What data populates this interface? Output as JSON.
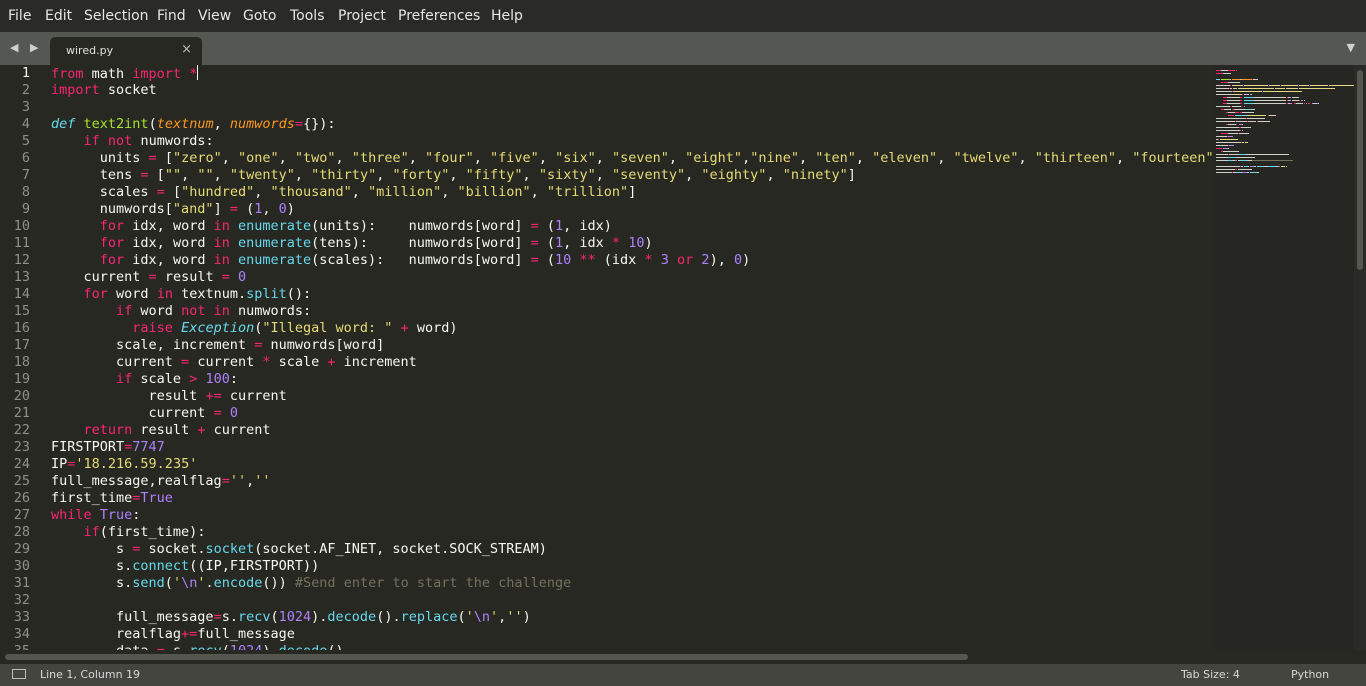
{
  "menu": [
    "File",
    "Edit",
    "Selection",
    "Find",
    "View",
    "Goto",
    "Tools",
    "Project",
    "Preferences",
    "Help"
  ],
  "tab": {
    "title": "wired.py",
    "close_glyph": "×"
  },
  "nav_arrows": "◀ ▶",
  "dropdown_glyph": "▼",
  "editor": {
    "current_line": 1,
    "lines": [
      {
        "n": "1",
        "t": [
          {
            "c": "kw",
            "s": "from"
          },
          {
            "s": " math "
          },
          {
            "c": "kw",
            "s": "import"
          },
          {
            "s": " "
          },
          {
            "c": "kw",
            "s": "*"
          }
        ]
      },
      {
        "n": "2",
        "t": [
          {
            "c": "kw",
            "s": "import"
          },
          {
            "s": " socket"
          }
        ]
      },
      {
        "n": "3",
        "t": []
      },
      {
        "n": "4",
        "t": [
          {
            "c": "sp",
            "s": "def"
          },
          {
            "s": " "
          },
          {
            "c": "fn",
            "s": "text2int"
          },
          {
            "s": "("
          },
          {
            "c": "pa",
            "s": "textnum"
          },
          {
            "s": ", "
          },
          {
            "c": "pa",
            "s": "numwords"
          },
          {
            "c": "kw",
            "s": "="
          },
          {
            "s": "{}):"
          }
        ]
      },
      {
        "n": "5",
        "t": [
          {
            "s": "    "
          },
          {
            "c": "kw",
            "s": "if"
          },
          {
            "s": " "
          },
          {
            "c": "kw",
            "s": "not"
          },
          {
            "s": " numwords:"
          }
        ]
      },
      {
        "n": "6",
        "t": [
          {
            "s": "      units "
          },
          {
            "c": "kw",
            "s": "="
          },
          {
            "s": " ["
          },
          {
            "c": "st",
            "s": "\"zero\""
          },
          {
            "s": ", "
          },
          {
            "c": "st",
            "s": "\"one\""
          },
          {
            "s": ", "
          },
          {
            "c": "st",
            "s": "\"two\""
          },
          {
            "s": ", "
          },
          {
            "c": "st",
            "s": "\"three\""
          },
          {
            "s": ", "
          },
          {
            "c": "st",
            "s": "\"four\""
          },
          {
            "s": ", "
          },
          {
            "c": "st",
            "s": "\"five\""
          },
          {
            "s": ", "
          },
          {
            "c": "st",
            "s": "\"six\""
          },
          {
            "s": ", "
          },
          {
            "c": "st",
            "s": "\"seven\""
          },
          {
            "s": ", "
          },
          {
            "c": "st",
            "s": "\"eight\""
          },
          {
            "s": ","
          },
          {
            "c": "st",
            "s": "\"nine\""
          },
          {
            "s": ", "
          },
          {
            "c": "st",
            "s": "\"ten\""
          },
          {
            "s": ", "
          },
          {
            "c": "st",
            "s": "\"eleven\""
          },
          {
            "s": ", "
          },
          {
            "c": "st",
            "s": "\"twelve\""
          },
          {
            "s": ", "
          },
          {
            "c": "st",
            "s": "\"thirteen\""
          },
          {
            "s": ", "
          },
          {
            "c": "st",
            "s": "\"fourteen\""
          },
          {
            "s": ","
          }
        ]
      },
      {
        "n": "7",
        "t": [
          {
            "s": "      tens "
          },
          {
            "c": "kw",
            "s": "="
          },
          {
            "s": " ["
          },
          {
            "c": "st",
            "s": "\"\""
          },
          {
            "s": ", "
          },
          {
            "c": "st",
            "s": "\"\""
          },
          {
            "s": ", "
          },
          {
            "c": "st",
            "s": "\"twenty\""
          },
          {
            "s": ", "
          },
          {
            "c": "st",
            "s": "\"thirty\""
          },
          {
            "s": ", "
          },
          {
            "c": "st",
            "s": "\"forty\""
          },
          {
            "s": ", "
          },
          {
            "c": "st",
            "s": "\"fifty\""
          },
          {
            "s": ", "
          },
          {
            "c": "st",
            "s": "\"sixty\""
          },
          {
            "s": ", "
          },
          {
            "c": "st",
            "s": "\"seventy\""
          },
          {
            "s": ", "
          },
          {
            "c": "st",
            "s": "\"eighty\""
          },
          {
            "s": ", "
          },
          {
            "c": "st",
            "s": "\"ninety\""
          },
          {
            "s": "]"
          }
        ]
      },
      {
        "n": "8",
        "t": [
          {
            "s": "      scales "
          },
          {
            "c": "kw",
            "s": "="
          },
          {
            "s": " ["
          },
          {
            "c": "st",
            "s": "\"hundred\""
          },
          {
            "s": ", "
          },
          {
            "c": "st",
            "s": "\"thousand\""
          },
          {
            "s": ", "
          },
          {
            "c": "st",
            "s": "\"million\""
          },
          {
            "s": ", "
          },
          {
            "c": "st",
            "s": "\"billion\""
          },
          {
            "s": ", "
          },
          {
            "c": "st",
            "s": "\"trillion\""
          },
          {
            "s": "]"
          }
        ]
      },
      {
        "n": "9",
        "t": [
          {
            "s": "      numwords["
          },
          {
            "c": "st",
            "s": "\"and\""
          },
          {
            "s": "] "
          },
          {
            "c": "kw",
            "s": "="
          },
          {
            "s": " ("
          },
          {
            "c": "nu",
            "s": "1"
          },
          {
            "s": ", "
          },
          {
            "c": "nu",
            "s": "0"
          },
          {
            "s": ")"
          }
        ]
      },
      {
        "n": "10",
        "t": [
          {
            "s": "      "
          },
          {
            "c": "kw",
            "s": "for"
          },
          {
            "s": " idx, word "
          },
          {
            "c": "kw",
            "s": "in"
          },
          {
            "s": " "
          },
          {
            "c": "bi",
            "s": "enumerate"
          },
          {
            "s": "(units):    numwords[word] "
          },
          {
            "c": "kw",
            "s": "="
          },
          {
            "s": " ("
          },
          {
            "c": "nu",
            "s": "1"
          },
          {
            "s": ", idx)"
          }
        ]
      },
      {
        "n": "11",
        "t": [
          {
            "s": "      "
          },
          {
            "c": "kw",
            "s": "for"
          },
          {
            "s": " idx, word "
          },
          {
            "c": "kw",
            "s": "in"
          },
          {
            "s": " "
          },
          {
            "c": "bi",
            "s": "enumerate"
          },
          {
            "s": "(tens):     numwords[word] "
          },
          {
            "c": "kw",
            "s": "="
          },
          {
            "s": " ("
          },
          {
            "c": "nu",
            "s": "1"
          },
          {
            "s": ", idx "
          },
          {
            "c": "kw",
            "s": "*"
          },
          {
            "s": " "
          },
          {
            "c": "nu",
            "s": "10"
          },
          {
            "s": ")"
          }
        ]
      },
      {
        "n": "12",
        "t": [
          {
            "s": "      "
          },
          {
            "c": "kw",
            "s": "for"
          },
          {
            "s": " idx, word "
          },
          {
            "c": "kw",
            "s": "in"
          },
          {
            "s": " "
          },
          {
            "c": "bi",
            "s": "enumerate"
          },
          {
            "s": "(scales):   numwords[word] "
          },
          {
            "c": "kw",
            "s": "="
          },
          {
            "s": " ("
          },
          {
            "c": "nu",
            "s": "10"
          },
          {
            "s": " "
          },
          {
            "c": "kw",
            "s": "**"
          },
          {
            "s": " (idx "
          },
          {
            "c": "kw",
            "s": "*"
          },
          {
            "s": " "
          },
          {
            "c": "nu",
            "s": "3"
          },
          {
            "s": " "
          },
          {
            "c": "kw",
            "s": "or"
          },
          {
            "s": " "
          },
          {
            "c": "nu",
            "s": "2"
          },
          {
            "s": "), "
          },
          {
            "c": "nu",
            "s": "0"
          },
          {
            "s": ")"
          }
        ]
      },
      {
        "n": "13",
        "t": [
          {
            "s": "    current "
          },
          {
            "c": "kw",
            "s": "="
          },
          {
            "s": " result "
          },
          {
            "c": "kw",
            "s": "="
          },
          {
            "s": " "
          },
          {
            "c": "nu",
            "s": "0"
          }
        ]
      },
      {
        "n": "14",
        "t": [
          {
            "s": "    "
          },
          {
            "c": "kw",
            "s": "for"
          },
          {
            "s": " word "
          },
          {
            "c": "kw",
            "s": "in"
          },
          {
            "s": " textnum."
          },
          {
            "c": "bi",
            "s": "split"
          },
          {
            "s": "():"
          }
        ]
      },
      {
        "n": "15",
        "t": [
          {
            "s": "        "
          },
          {
            "c": "kw",
            "s": "if"
          },
          {
            "s": " word "
          },
          {
            "c": "kw",
            "s": "not"
          },
          {
            "s": " "
          },
          {
            "c": "kw",
            "s": "in"
          },
          {
            "s": " numwords:"
          }
        ]
      },
      {
        "n": "16",
        "t": [
          {
            "s": "          "
          },
          {
            "c": "kw",
            "s": "raise"
          },
          {
            "s": " "
          },
          {
            "c": "sp",
            "s": "Exception"
          },
          {
            "s": "("
          },
          {
            "c": "st",
            "s": "\"Illegal word: \""
          },
          {
            "s": " "
          },
          {
            "c": "kw",
            "s": "+"
          },
          {
            "s": " word)"
          }
        ]
      },
      {
        "n": "17",
        "t": [
          {
            "s": "        scale, increment "
          },
          {
            "c": "kw",
            "s": "="
          },
          {
            "s": " numwords[word]"
          }
        ]
      },
      {
        "n": "18",
        "t": [
          {
            "s": "        current "
          },
          {
            "c": "kw",
            "s": "="
          },
          {
            "s": " current "
          },
          {
            "c": "kw",
            "s": "*"
          },
          {
            "s": " scale "
          },
          {
            "c": "kw",
            "s": "+"
          },
          {
            "s": " increment"
          }
        ]
      },
      {
        "n": "19",
        "t": [
          {
            "s": "        "
          },
          {
            "c": "kw",
            "s": "if"
          },
          {
            "s": " scale "
          },
          {
            "c": "kw",
            "s": ">"
          },
          {
            "s": " "
          },
          {
            "c": "nu",
            "s": "100"
          },
          {
            "s": ":"
          }
        ]
      },
      {
        "n": "20",
        "t": [
          {
            "s": "            result "
          },
          {
            "c": "kw",
            "s": "+="
          },
          {
            "s": " current"
          }
        ]
      },
      {
        "n": "21",
        "t": [
          {
            "s": "            current "
          },
          {
            "c": "kw",
            "s": "="
          },
          {
            "s": " "
          },
          {
            "c": "nu",
            "s": "0"
          }
        ]
      },
      {
        "n": "22",
        "t": [
          {
            "s": "    "
          },
          {
            "c": "kw",
            "s": "return"
          },
          {
            "s": " result "
          },
          {
            "c": "kw",
            "s": "+"
          },
          {
            "s": " current"
          }
        ]
      },
      {
        "n": "23",
        "t": [
          {
            "s": "FIRSTPORT"
          },
          {
            "c": "kw",
            "s": "="
          },
          {
            "c": "nu",
            "s": "7747"
          }
        ]
      },
      {
        "n": "24",
        "t": [
          {
            "s": "IP"
          },
          {
            "c": "kw",
            "s": "="
          },
          {
            "c": "st",
            "s": "'18.216.59.235'"
          }
        ]
      },
      {
        "n": "25",
        "t": [
          {
            "s": "full_message,realflag"
          },
          {
            "c": "kw",
            "s": "="
          },
          {
            "c": "st",
            "s": "''"
          },
          {
            "s": ","
          },
          {
            "c": "st",
            "s": "''"
          }
        ]
      },
      {
        "n": "26",
        "t": [
          {
            "s": "first_time"
          },
          {
            "c": "kw",
            "s": "="
          },
          {
            "c": "nu",
            "s": "True"
          }
        ]
      },
      {
        "n": "27",
        "t": [
          {
            "c": "kw",
            "s": "while"
          },
          {
            "s": " "
          },
          {
            "c": "nu",
            "s": "True"
          },
          {
            "s": ":"
          }
        ]
      },
      {
        "n": "28",
        "t": [
          {
            "s": "    "
          },
          {
            "c": "kw",
            "s": "if"
          },
          {
            "s": "(first_time):"
          }
        ]
      },
      {
        "n": "29",
        "t": [
          {
            "s": "        s "
          },
          {
            "c": "kw",
            "s": "="
          },
          {
            "s": " socket."
          },
          {
            "c": "bi",
            "s": "socket"
          },
          {
            "s": "(socket.AF_INET, socket.SOCK_STREAM)"
          }
        ]
      },
      {
        "n": "30",
        "t": [
          {
            "s": "        s."
          },
          {
            "c": "bi",
            "s": "connect"
          },
          {
            "s": "((IP,FIRSTPORT))"
          }
        ]
      },
      {
        "n": "31",
        "t": [
          {
            "s": "        s."
          },
          {
            "c": "bi",
            "s": "send"
          },
          {
            "s": "("
          },
          {
            "c": "st",
            "s": "'"
          },
          {
            "c": "nu",
            "s": "\\n"
          },
          {
            "c": "st",
            "s": "'"
          },
          {
            "s": "."
          },
          {
            "c": "bi",
            "s": "encode"
          },
          {
            "s": "()) "
          },
          {
            "c": "cm",
            "s": "#Send enter to start the challenge"
          }
        ]
      },
      {
        "n": "32",
        "t": []
      },
      {
        "n": "33",
        "t": [
          {
            "s": "        full_message"
          },
          {
            "c": "kw",
            "s": "="
          },
          {
            "s": "s."
          },
          {
            "c": "bi",
            "s": "recv"
          },
          {
            "s": "("
          },
          {
            "c": "nu",
            "s": "1024"
          },
          {
            "s": ")."
          },
          {
            "c": "bi",
            "s": "decode"
          },
          {
            "s": "()."
          },
          {
            "c": "bi",
            "s": "replace"
          },
          {
            "s": "("
          },
          {
            "c": "st",
            "s": "'"
          },
          {
            "c": "nu",
            "s": "\\n"
          },
          {
            "c": "st",
            "s": "'"
          },
          {
            "s": ","
          },
          {
            "c": "st",
            "s": "''"
          },
          {
            "s": ")"
          }
        ]
      },
      {
        "n": "34",
        "t": [
          {
            "s": "        realflag"
          },
          {
            "c": "kw",
            "s": "+="
          },
          {
            "s": "full_message"
          }
        ]
      },
      {
        "n": "35",
        "t": [
          {
            "s": "        data "
          },
          {
            "c": "kw",
            "s": "="
          },
          {
            "s": " s."
          },
          {
            "c": "bi",
            "s": "recv"
          },
          {
            "s": "("
          },
          {
            "c": "nu",
            "s": "1024"
          },
          {
            "s": ")."
          },
          {
            "c": "bi",
            "s": "decode"
          },
          {
            "s": "()"
          }
        ]
      }
    ]
  },
  "status": {
    "position": "Line 1, Column 19",
    "tab_size": "Tab Size: 4",
    "syntax": "Python"
  },
  "colors": {
    "background": "#272822",
    "keyword": "#f92672",
    "string": "#e6db74",
    "number": "#ae81ff",
    "function": "#a6e22e",
    "builtin": "#66d9ef",
    "param": "#fd971f",
    "comment": "#75715e"
  }
}
